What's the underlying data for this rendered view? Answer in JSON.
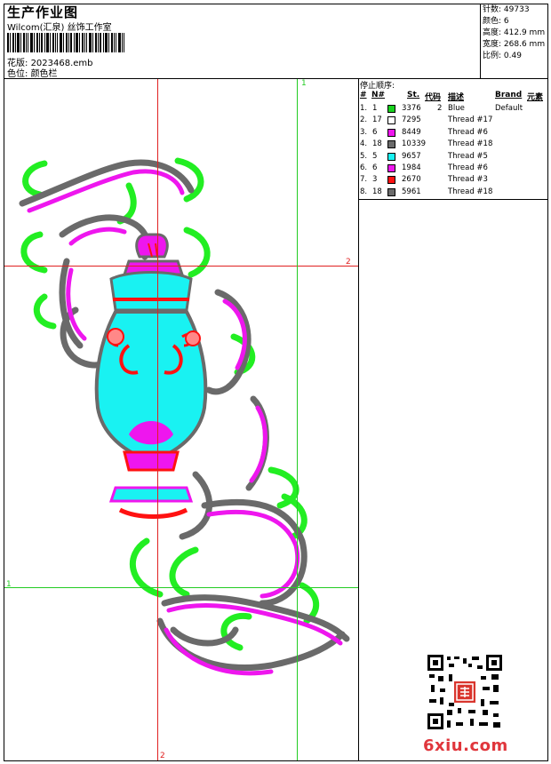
{
  "header": {
    "title": "生产作业图",
    "subtitle": "Wilcom(汇泉) 丝饰工作室",
    "design_label": "花版:",
    "design_file": "2023468.emb",
    "color_label": "色位:",
    "color_value": "颜色栏"
  },
  "stats": [
    {
      "label": "针数:",
      "value": "49733"
    },
    {
      "label": "颜色:",
      "value": "6"
    },
    {
      "label": "高度:",
      "value": "412.9 mm"
    },
    {
      "label": "宽度:",
      "value": "268.6 mm"
    },
    {
      "label": "比例:",
      "value": "0.49"
    }
  ],
  "stop_sequence": {
    "title": "停止顺序:",
    "headers": {
      "num": "#",
      "n": "N#",
      "st": "St.",
      "code": "代码",
      "desc": "描述",
      "brand": "Brand",
      "element": "元素"
    },
    "rows": [
      {
        "idx": "1.",
        "n": "1",
        "color": "#18d21e",
        "st": "3376",
        "code": "2",
        "desc": "Blue",
        "brand": "Default"
      },
      {
        "idx": "2.",
        "n": "17",
        "color": "#ffffff",
        "st": "7295",
        "code": "",
        "desc": "Thread #17",
        "brand": ""
      },
      {
        "idx": "3.",
        "n": "6",
        "color": "#ee16ee",
        "st": "8449",
        "code": "",
        "desc": "Thread #6",
        "brand": ""
      },
      {
        "idx": "4.",
        "n": "18",
        "color": "#6a6a6a",
        "st": "10339",
        "code": "",
        "desc": "Thread #18",
        "brand": ""
      },
      {
        "idx": "5.",
        "n": "5",
        "color": "#19f2f2",
        "st": "9657",
        "code": "",
        "desc": "Thread #5",
        "brand": ""
      },
      {
        "idx": "6.",
        "n": "6",
        "color": "#ee16ee",
        "st": "1984",
        "code": "",
        "desc": "Thread #6",
        "brand": ""
      },
      {
        "idx": "7.",
        "n": "3",
        "color": "#ff1111",
        "st": "2670",
        "code": "",
        "desc": "Thread #3",
        "brand": ""
      },
      {
        "idx": "8.",
        "n": "18",
        "color": "#6a6a6a",
        "st": "5961",
        "code": "",
        "desc": "Thread #18",
        "brand": ""
      }
    ]
  },
  "guides": {
    "label_1": "1",
    "label_2": "2"
  },
  "logo": {
    "text": "6xiu.com"
  },
  "colors": {
    "guide_red": "#e02020",
    "guide_green": "#22cc22"
  }
}
